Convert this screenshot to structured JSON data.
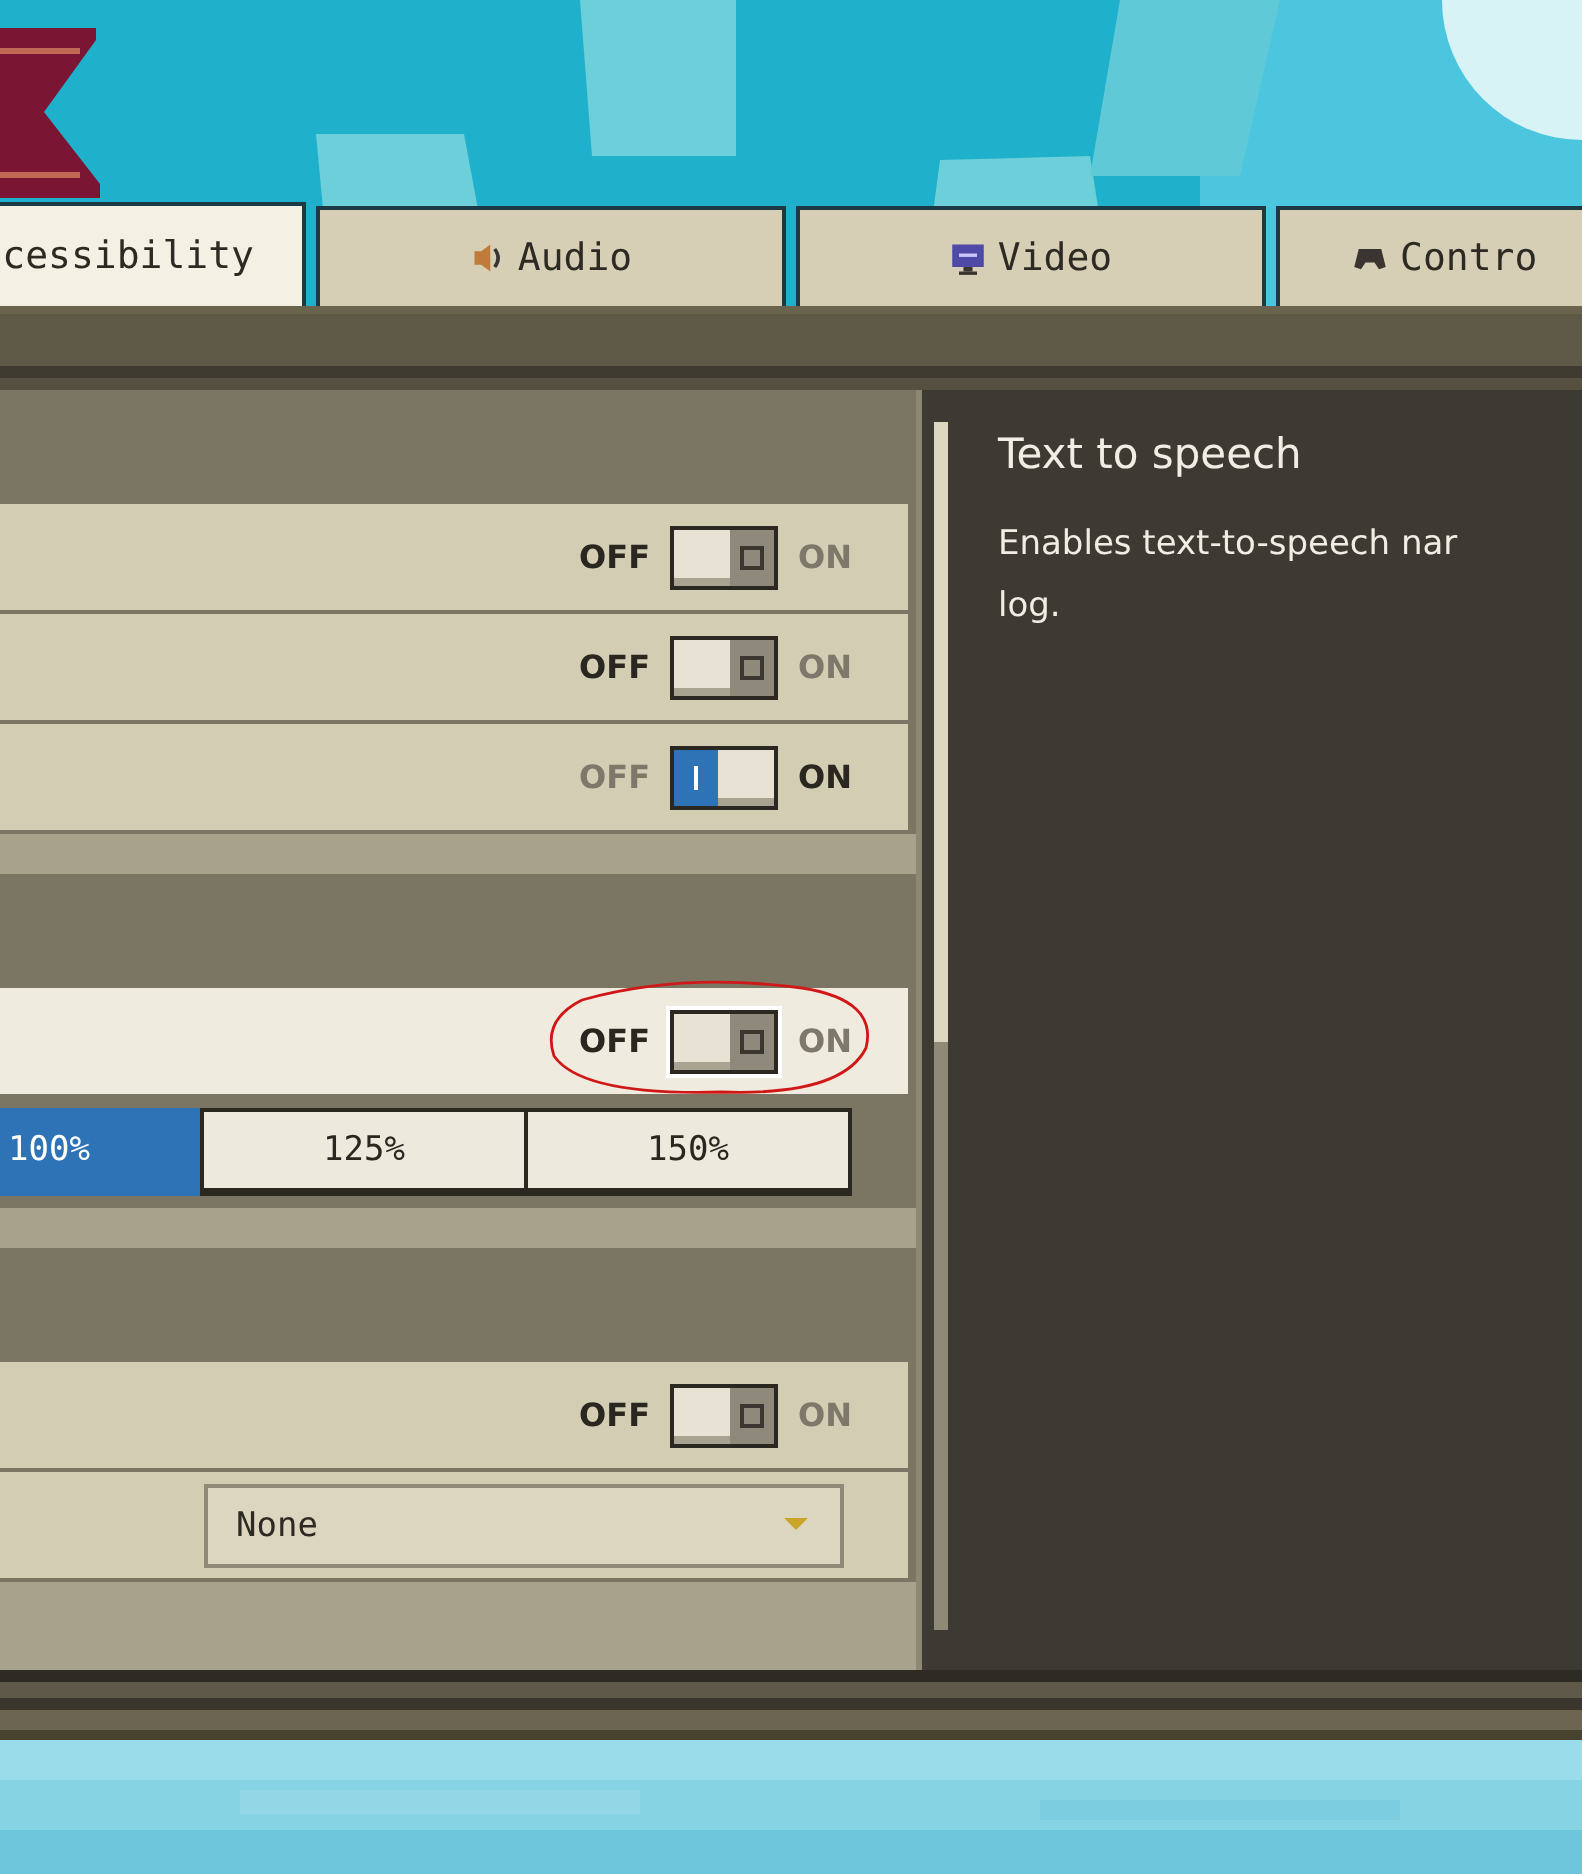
{
  "tabs": [
    {
      "label": "cessibility",
      "selected": true
    },
    {
      "label": "Audio",
      "selected": false
    },
    {
      "label": "Video",
      "selected": false
    },
    {
      "label": "Contro",
      "selected": false
    }
  ],
  "sections": [
    {
      "rows": [
        {
          "kind": "toggle",
          "off_label": "OFF",
          "on_label": "ON",
          "on": false,
          "focused": false,
          "circled": false
        },
        {
          "kind": "toggle",
          "off_label": "OFF",
          "on_label": "ON",
          "on": false,
          "focused": false,
          "circled": false
        },
        {
          "kind": "toggle",
          "off_label": "OFF",
          "on_label": "ON",
          "on": true,
          "focused": false,
          "circled": false
        }
      ]
    },
    {
      "rows": [
        {
          "kind": "toggle",
          "off_label": "OFF",
          "on_label": "ON",
          "on": false,
          "focused": true,
          "circled": true
        },
        {
          "kind": "segmented",
          "options": [
            {
              "label": "100%",
              "selected": true
            },
            {
              "label": "125%",
              "selected": false
            },
            {
              "label": "150%",
              "selected": false
            }
          ]
        }
      ]
    },
    {
      "rows": [
        {
          "kind": "toggle",
          "off_label": "OFF",
          "on_label": "ON",
          "on": false,
          "focused": false,
          "circled": false
        },
        {
          "kind": "dropdown",
          "value": "None"
        }
      ]
    }
  ],
  "description": {
    "title": "Text to speech",
    "lines": [
      "Enables text-to-speech nar",
      "log."
    ]
  }
}
